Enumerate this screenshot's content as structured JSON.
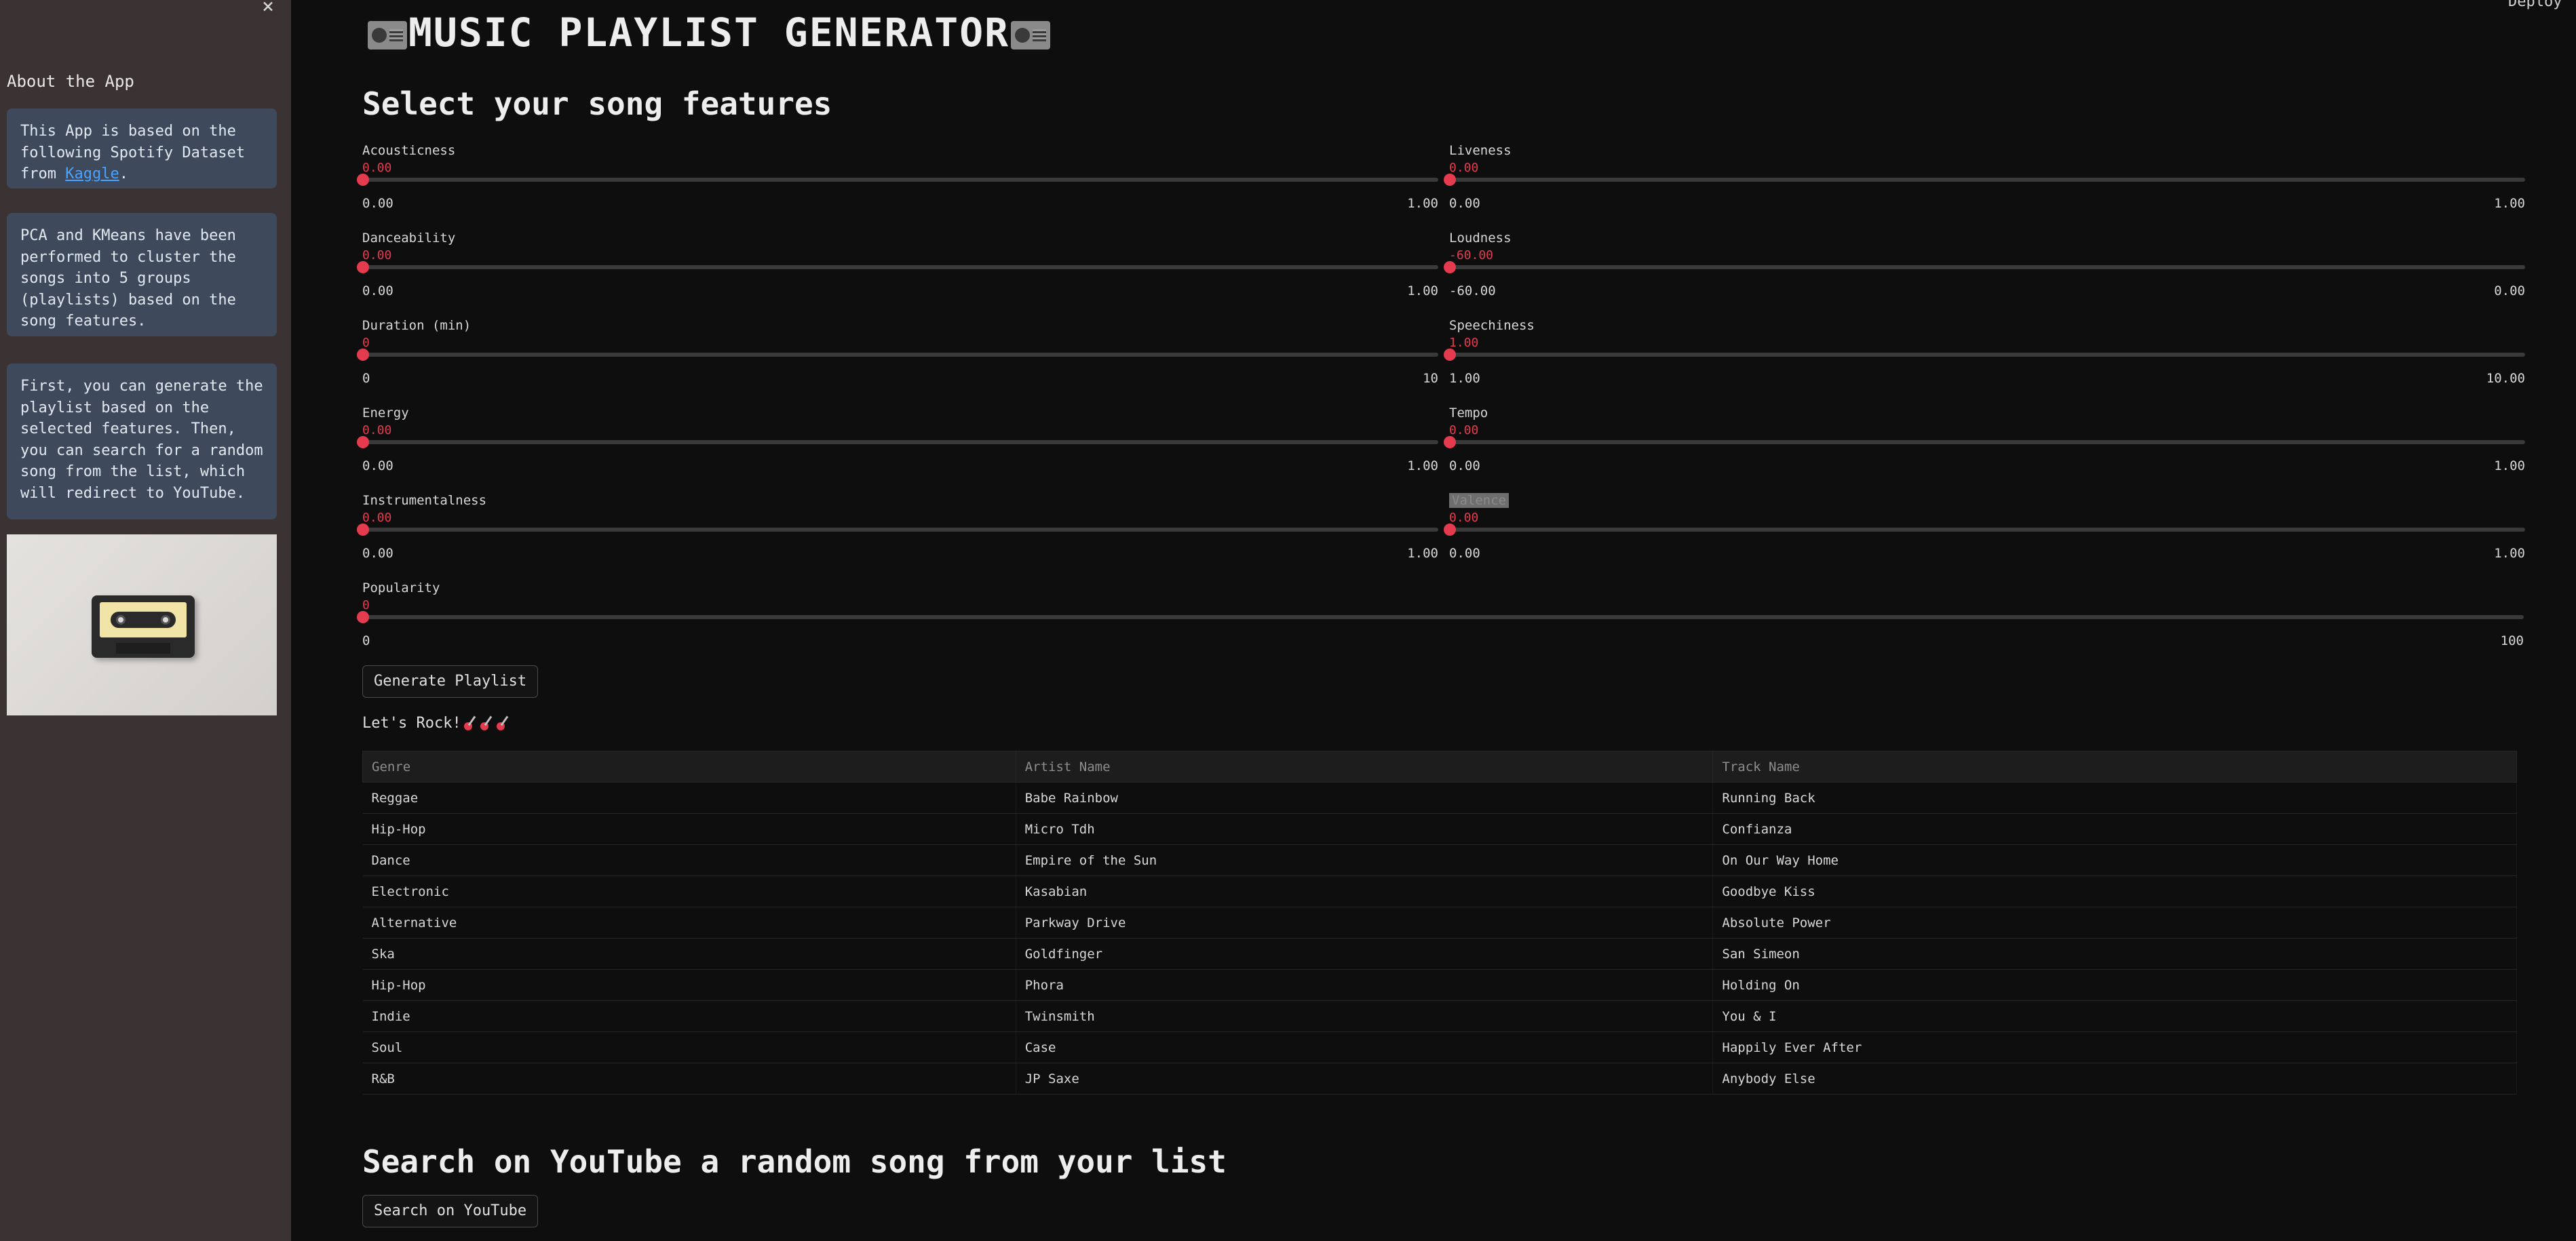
{
  "sidebar": {
    "close_icon": "close-icon",
    "title": "About the App",
    "info1_before": "This App is based on the following Spotify Dataset from ",
    "info1_link": "Kaggle",
    "info1_after": ".",
    "info2": "PCA and KMeans have been performed to cluster the songs into 5 groups (playlists) based on the song features.",
    "info3": "First, you can generate the playlist based on the selected features. Then, you can search for a random song from the list, which will redirect to YouTube.",
    "image_icon": "cassette-tape-image"
  },
  "header": {
    "deploy": "Deploy",
    "title": "MUSIC PLAYLIST GENERATOR",
    "title_icon": "radio-icon"
  },
  "features": {
    "title": "Select your song features",
    "left": [
      {
        "label": "Acousticness",
        "value": "0.00",
        "min": "0.00",
        "max": "1.00"
      },
      {
        "label": "Danceability",
        "value": "0.00",
        "min": "0.00",
        "max": "1.00"
      },
      {
        "label": "Duration (min)",
        "value": "0",
        "min": "0",
        "max": "10"
      },
      {
        "label": "Energy",
        "value": "0.00",
        "min": "0.00",
        "max": "1.00"
      },
      {
        "label": "Instrumentalness",
        "value": "0.00",
        "min": "0.00",
        "max": "1.00"
      },
      {
        "label": "Popularity",
        "value": "0",
        "min": "0",
        "max": "100"
      }
    ],
    "right": [
      {
        "label": "Liveness",
        "value": "0.00",
        "min": "0.00",
        "max": "1.00"
      },
      {
        "label": "Loudness",
        "value": "-60.00",
        "min": "-60.00",
        "max": "0.00"
      },
      {
        "label": "Speechiness",
        "value": "1.00",
        "min": "1.00",
        "max": "10.00"
      },
      {
        "label": "Tempo",
        "value": "0.00",
        "min": "0.00",
        "max": "1.00"
      },
      {
        "label": "Valence",
        "value": "0.00",
        "min": "0.00",
        "max": "1.00"
      }
    ],
    "accent_color": "#e53b4e"
  },
  "generate_button": "Generate Playlist",
  "lets_rock": "Let's Rock!",
  "lets_rock_icon": "guitar-icon",
  "table": {
    "columns": [
      "Genre",
      "Artist Name",
      "Track Name"
    ],
    "rows": [
      [
        "Reggae",
        "Babe Rainbow",
        "Running Back"
      ],
      [
        "Hip-Hop",
        "Micro Tdh",
        "Confianza"
      ],
      [
        "Dance",
        "Empire of the Sun",
        "On Our Way Home"
      ],
      [
        "Electronic",
        "Kasabian",
        "Goodbye Kiss"
      ],
      [
        "Alternative",
        "Parkway Drive",
        "Absolute Power"
      ],
      [
        "Ska",
        "Goldfinger",
        "San Simeon"
      ],
      [
        "Hip-Hop",
        "Phora",
        "Holding On"
      ],
      [
        "Indie",
        "Twinsmith",
        "You & I"
      ],
      [
        "Soul",
        "Case",
        "Happily Ever After"
      ],
      [
        "R&B",
        "JP Saxe",
        "Anybody Else"
      ]
    ]
  },
  "search": {
    "title": "Search on YouTube a random song from your list",
    "button": "Search on YouTube"
  }
}
